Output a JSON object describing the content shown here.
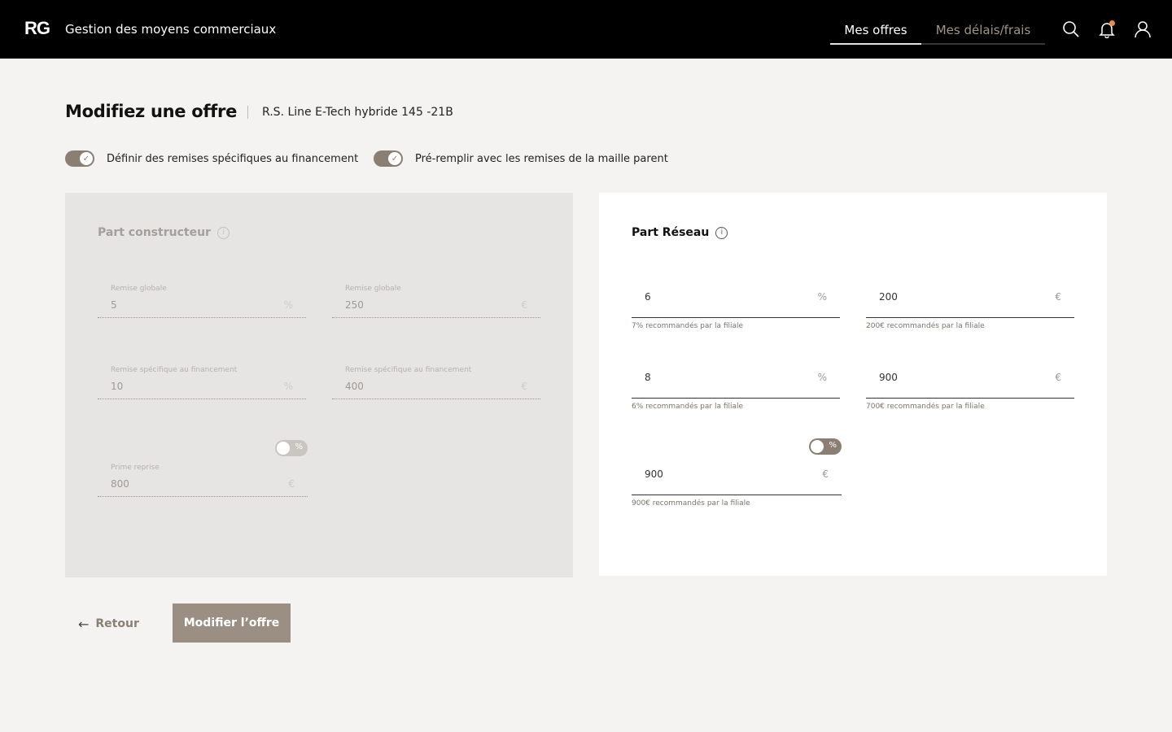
{
  "header": {
    "logo": "RG",
    "app_title": "Gestion des moyens commerciaux",
    "nav": [
      {
        "label": "Mes offres",
        "active": true
      },
      {
        "label": "Mes délais/frais",
        "active": false
      }
    ],
    "icons": [
      "search-icon",
      "bell-icon",
      "user-icon"
    ],
    "notification_dot_color": "#f08a4b"
  },
  "page": {
    "title": "Modifiez une offre",
    "offer_name": "R.S. Line E-Tech hybride 145 -21B"
  },
  "toggles": [
    {
      "label": "Définir des remises spécifiques au financement",
      "on": true
    },
    {
      "label": "Pré-remplir avec les remises de la maille parent",
      "on": true
    }
  ],
  "constructeur": {
    "title": "Part constructeur",
    "fields": [
      {
        "label": "Remise globale",
        "value": "5",
        "unit": "%"
      },
      {
        "label": "Remise globale",
        "value": "250",
        "unit": "€"
      },
      {
        "label": "Remise spécifique au financement",
        "value": "10",
        "unit": "%"
      },
      {
        "label": "Remise spécifique au financement",
        "value": "400",
        "unit": "€"
      },
      {
        "label": "Prime reprise",
        "value": "800",
        "unit": "€"
      }
    ],
    "pct_toggle": "%"
  },
  "reseau": {
    "title": "Part Réseau",
    "fields": [
      {
        "value": "6",
        "unit": "%",
        "hint": "7% recommandés par la filiale"
      },
      {
        "value": "200",
        "unit": "€",
        "hint": "200€ recommandés par la filiale"
      },
      {
        "value": "8",
        "unit": "%",
        "hint": "6% recommandés par la filiale"
      },
      {
        "value": "900",
        "unit": "€",
        "hint": "700€ recommandés par la filiale"
      },
      {
        "value": "900",
        "unit": "€",
        "hint": "900€ recommandés par la filiale"
      }
    ],
    "pct_toggle": "%"
  },
  "footer": {
    "back_label": "Retour",
    "submit_label": "Modifier l’offre"
  },
  "colors": {
    "accent": "#8a7f72",
    "button": "#9a8f82",
    "background": "#f4f3f1"
  }
}
